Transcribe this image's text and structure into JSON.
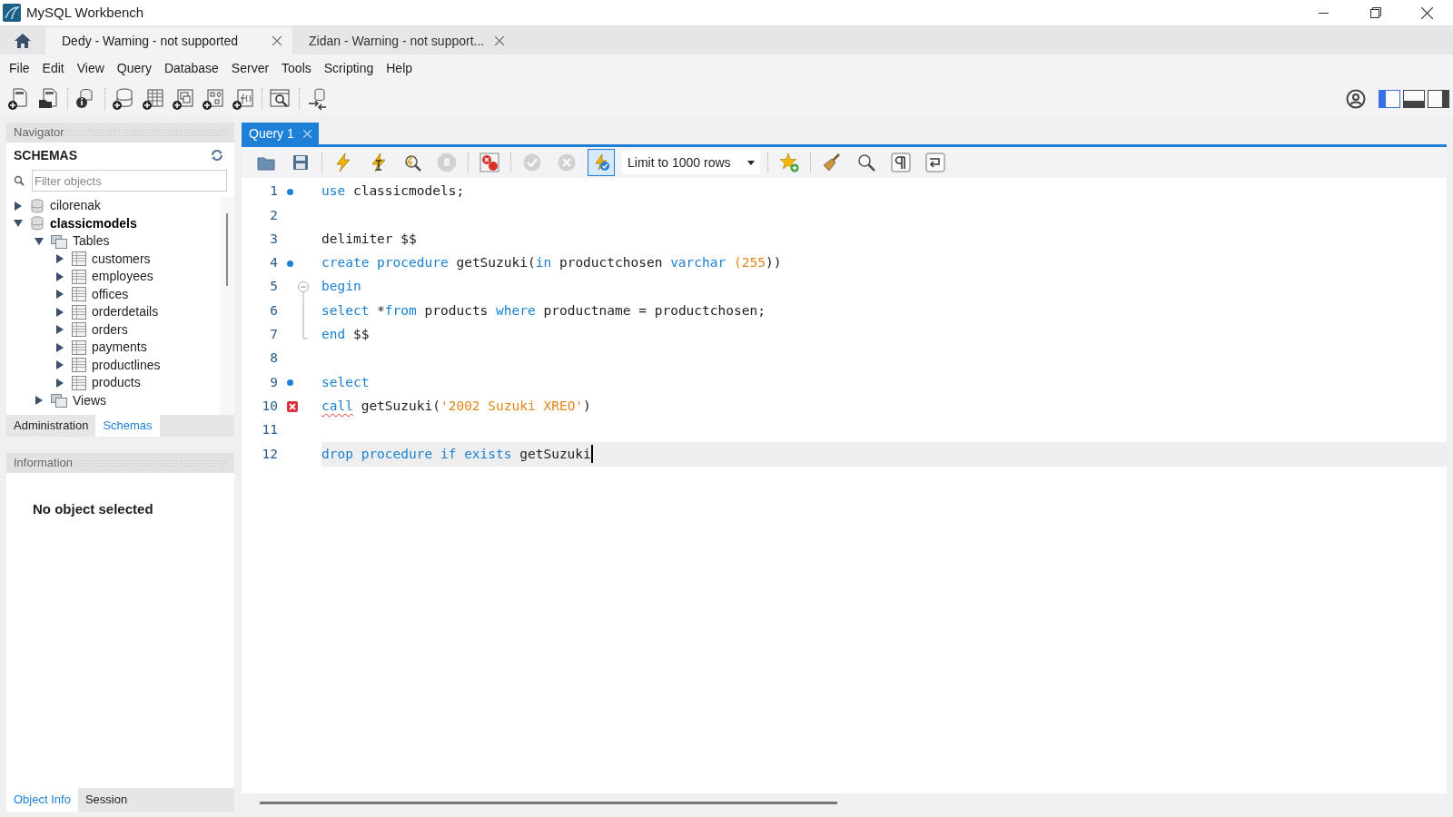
{
  "window": {
    "title": "MySQL Workbench"
  },
  "connection_tabs": [
    {
      "label": "Dedy - Waming - not supported",
      "selected": true
    },
    {
      "label": "Zidan - Warning - not support...",
      "selected": false
    }
  ],
  "menu": [
    "File",
    "Edit",
    "View",
    "Query",
    "Database",
    "Server",
    "Tools",
    "Scripting",
    "Help"
  ],
  "toolbar": [
    {
      "kind": "new-sql"
    },
    {
      "kind": "open-sql"
    },
    {
      "kind": "sep"
    },
    {
      "kind": "inspector"
    },
    {
      "kind": "sep"
    },
    {
      "kind": "new-schema"
    },
    {
      "kind": "new-table"
    },
    {
      "kind": "new-view"
    },
    {
      "kind": "new-routine"
    },
    {
      "kind": "new-function"
    },
    {
      "kind": "sep"
    },
    {
      "kind": "search-data"
    },
    {
      "kind": "sep"
    },
    {
      "kind": "reconnect"
    }
  ],
  "layout_toggles": [
    {
      "kind": "left",
      "selected": true
    },
    {
      "kind": "bottom",
      "selected": false
    },
    {
      "kind": "right",
      "selected": false
    }
  ],
  "navigator": {
    "title": "Navigator",
    "section": "SCHEMAS",
    "filter": {
      "placeholder": "Filter objects"
    },
    "tree": [
      {
        "label": "cilorenak",
        "kind": "schema",
        "expanded": false,
        "default": false
      },
      {
        "label": "classicmodels",
        "kind": "schema",
        "expanded": true,
        "default": true,
        "children": [
          {
            "label": "Tables",
            "kind": "folder",
            "expanded": true,
            "children": [
              {
                "label": "customers",
                "kind": "table",
                "expanded": false
              },
              {
                "label": "employees",
                "kind": "table",
                "expanded": false
              },
              {
                "label": "offices",
                "kind": "table",
                "expanded": false
              },
              {
                "label": "orderdetails",
                "kind": "table",
                "expanded": false
              },
              {
                "label": "orders",
                "kind": "table",
                "expanded": false
              },
              {
                "label": "payments",
                "kind": "table",
                "expanded": false
              },
              {
                "label": "productlines",
                "kind": "table",
                "expanded": false
              },
              {
                "label": "products",
                "kind": "table",
                "expanded": false
              }
            ]
          },
          {
            "label": "Views",
            "kind": "folder",
            "expanded": false
          }
        ]
      }
    ],
    "tabs": [
      {
        "label": "Administration",
        "selected": false
      },
      {
        "label": "Schemas",
        "selected": true
      }
    ]
  },
  "information": {
    "title": "Information",
    "message": "No object selected",
    "tabs": [
      {
        "label": "Object Info",
        "selected": true
      },
      {
        "label": "Session",
        "selected": false
      }
    ]
  },
  "query_tabs": [
    {
      "label": "Query 1",
      "selected": true
    }
  ],
  "editor_toolbar": [
    {
      "kind": "open",
      "disabled": false
    },
    {
      "kind": "save",
      "disabled": false
    },
    {
      "kind": "sep"
    },
    {
      "kind": "execute",
      "disabled": false
    },
    {
      "kind": "execute-current",
      "disabled": false
    },
    {
      "kind": "explain",
      "disabled": false
    },
    {
      "kind": "stop",
      "disabled": true
    },
    {
      "kind": "sep"
    },
    {
      "kind": "stop-on-error",
      "disabled": false
    },
    {
      "kind": "sep"
    },
    {
      "kind": "commit",
      "disabled": true
    },
    {
      "kind": "rollback",
      "disabled": true
    },
    {
      "kind": "autocommit",
      "disabled": false,
      "selected": true
    },
    {
      "kind": "limit",
      "label": "Limit to 1000 rows"
    },
    {
      "kind": "sep"
    },
    {
      "kind": "snippet",
      "disabled": false
    },
    {
      "kind": "sep"
    },
    {
      "kind": "beautify",
      "disabled": false
    },
    {
      "kind": "find",
      "disabled": false
    },
    {
      "kind": "invisibles",
      "disabled": false
    },
    {
      "kind": "wrap",
      "disabled": false
    }
  ],
  "editor": {
    "lines": [
      {
        "number": "1",
        "kind": "statement",
        "tokens": [
          {
            "text": "use",
            "kind": "kw"
          },
          {
            "text": " classicmodels;",
            "kind": "plain"
          }
        ]
      },
      {
        "number": "2",
        "kind": "plain"
      },
      {
        "number": "3",
        "kind": "plain",
        "tokens": [
          {
            "text": "delimiter $$",
            "kind": "plain"
          }
        ]
      },
      {
        "number": "4",
        "kind": "statement",
        "tokens": [
          {
            "text": "create procedure",
            "kind": "kw"
          },
          {
            "text": " getSuzuki(",
            "kind": "plain"
          },
          {
            "text": "in",
            "kind": "kw"
          },
          {
            "text": " productchosen ",
            "kind": "plain"
          },
          {
            "text": "varchar",
            "kind": "kw"
          },
          {
            "text": " (",
            "kind": "lit"
          },
          {
            "text": "255",
            "kind": "lit"
          },
          {
            "text": "))",
            "kind": "plain"
          }
        ]
      },
      {
        "number": "5",
        "kind": "fold_start",
        "tokens": [
          {
            "text": "begin",
            "kind": "kw"
          }
        ]
      },
      {
        "number": "6",
        "kind": "fold_mid",
        "tokens": [
          {
            "text": "select",
            "kind": "kw"
          },
          {
            "text": " *",
            "kind": "plain"
          },
          {
            "text": "from",
            "kind": "kw"
          },
          {
            "text": " products ",
            "kind": "plain"
          },
          {
            "text": "where",
            "kind": "kw"
          },
          {
            "text": " productname = productchosen;",
            "kind": "plain"
          }
        ]
      },
      {
        "number": "7",
        "kind": "fold_end",
        "tokens": [
          {
            "text": "end",
            "kind": "kw"
          },
          {
            "text": " $$",
            "kind": "plain"
          }
        ]
      },
      {
        "number": "8",
        "kind": "plain"
      },
      {
        "number": "9",
        "kind": "statement",
        "tokens": [
          {
            "text": "select",
            "kind": "kw"
          }
        ]
      },
      {
        "number": "10",
        "kind": "error",
        "tokens": [
          {
            "text": "call",
            "kind": "kw_error"
          },
          {
            "text": " getSuzuki(",
            "kind": "plain"
          },
          {
            "text": "'2002 Suzuki XREO'",
            "kind": "lit"
          },
          {
            "text": ")",
            "kind": "plain"
          }
        ]
      },
      {
        "number": "11",
        "kind": "plain"
      },
      {
        "number": "12",
        "kind": "plain",
        "current": true,
        "tokens": [
          {
            "text": "drop procedure if exists",
            "kind": "kw"
          },
          {
            "text": " getSuzuki",
            "kind": "plain"
          }
        ]
      }
    ]
  }
}
